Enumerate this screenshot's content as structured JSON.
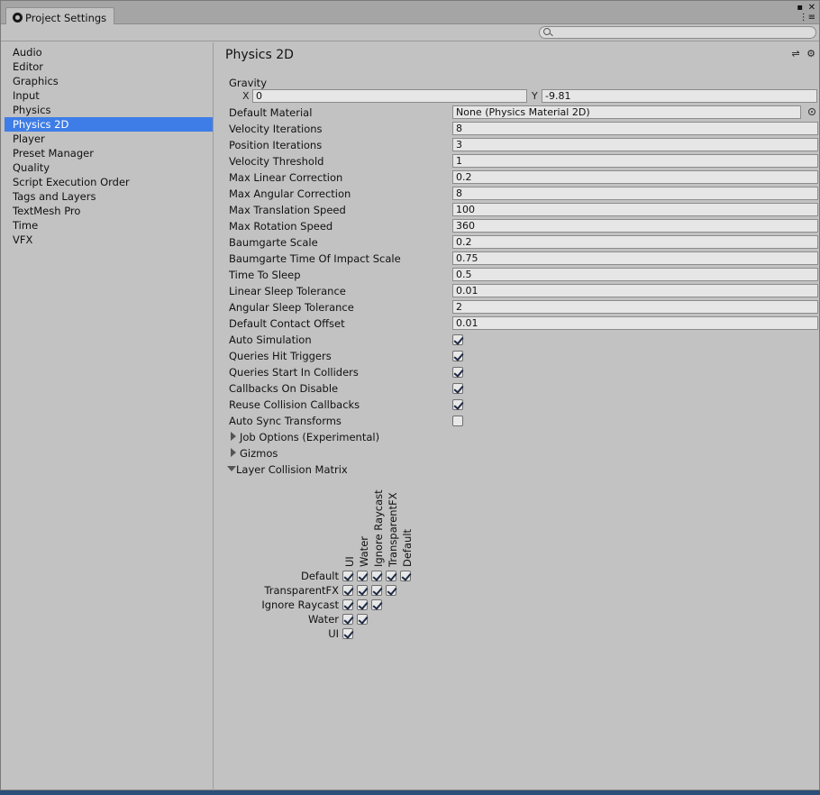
{
  "window": {
    "tab_title": "Project Settings",
    "close_glyph": "✕",
    "max_glyph": "▪",
    "menu_glyph": "⋮≡"
  },
  "sidebar": {
    "items": [
      {
        "label": "Audio",
        "selected": false
      },
      {
        "label": "Editor",
        "selected": false
      },
      {
        "label": "Graphics",
        "selected": false
      },
      {
        "label": "Input",
        "selected": false
      },
      {
        "label": "Physics",
        "selected": false
      },
      {
        "label": "Physics 2D",
        "selected": true
      },
      {
        "label": "Player",
        "selected": false
      },
      {
        "label": "Preset Manager",
        "selected": false
      },
      {
        "label": "Quality",
        "selected": false
      },
      {
        "label": "Script Execution Order",
        "selected": false
      },
      {
        "label": "Tags and Layers",
        "selected": false
      },
      {
        "label": "TextMesh Pro",
        "selected": false
      },
      {
        "label": "Time",
        "selected": false
      },
      {
        "label": "VFX",
        "selected": false
      }
    ]
  },
  "content": {
    "title": "Physics 2D",
    "title_icons": "⇌ ⚙",
    "gravity": {
      "label": "Gravity",
      "x_label": "X",
      "x": "0",
      "y_label": "Y",
      "y": "-9.81"
    },
    "default_material": {
      "label": "Default Material",
      "value": "None (Physics Material 2D)"
    },
    "fields": [
      {
        "label": "Velocity Iterations",
        "value": "8"
      },
      {
        "label": "Position Iterations",
        "value": "3"
      },
      {
        "label": "Velocity Threshold",
        "value": "1"
      },
      {
        "label": "Max Linear Correction",
        "value": "0.2"
      },
      {
        "label": "Max Angular Correction",
        "value": "8"
      },
      {
        "label": "Max Translation Speed",
        "value": "100"
      },
      {
        "label": "Max Rotation Speed",
        "value": "360"
      },
      {
        "label": "Baumgarte Scale",
        "value": "0.2"
      },
      {
        "label": "Baumgarte Time Of Impact Scale",
        "value": "0.75"
      },
      {
        "label": "Time To Sleep",
        "value": "0.5"
      },
      {
        "label": "Linear Sleep Tolerance",
        "value": "0.01"
      },
      {
        "label": "Angular Sleep Tolerance",
        "value": "2"
      },
      {
        "label": "Default Contact Offset",
        "value": "0.01"
      }
    ],
    "toggles": [
      {
        "label": "Auto Simulation",
        "checked": true
      },
      {
        "label": "Queries Hit Triggers",
        "checked": true
      },
      {
        "label": "Queries Start In Colliders",
        "checked": true
      },
      {
        "label": "Callbacks On Disable",
        "checked": true
      },
      {
        "label": "Reuse Collision Callbacks",
        "checked": true
      },
      {
        "label": "Auto Sync Transforms",
        "checked": false
      }
    ],
    "foldouts": [
      {
        "label": "Job Options (Experimental)",
        "open": false
      },
      {
        "label": "Gizmos",
        "open": false
      },
      {
        "label": "Layer Collision Matrix",
        "open": true
      }
    ],
    "matrix": {
      "columns": [
        "UI",
        "Water",
        "Ignore Raycast",
        "TransparentFX",
        "Default"
      ],
      "rows": [
        "Default",
        "TransparentFX",
        "Ignore Raycast",
        "Water",
        "UI"
      ]
    }
  }
}
